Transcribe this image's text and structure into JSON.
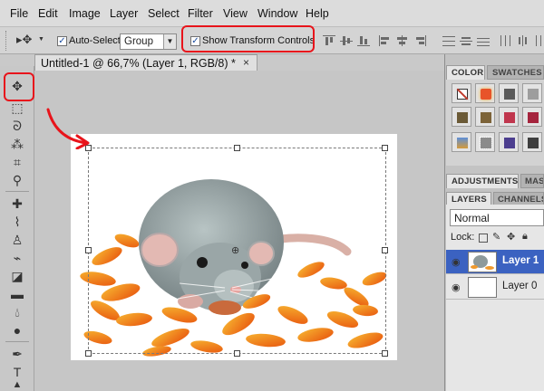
{
  "menu": [
    "File",
    "Edit",
    "Image",
    "Layer",
    "Select",
    "Filter",
    "View",
    "Window",
    "Help"
  ],
  "options": {
    "auto_select_label": "Auto-Select:",
    "auto_select_value": "Group",
    "show_transform_label": "Show Transform Controls",
    "check_mark": "✓"
  },
  "document": {
    "tab_title": "Untitled-1 @ 66,7% (Layer 1, RGB/8) *",
    "close_glyph": "×"
  },
  "panels": {
    "color_tab": "COLOR",
    "swatches_tab": "SWATCHES",
    "adjustments_tab": "ADJUSTMENTS",
    "masks_tab": "MAS",
    "layers_tab": "LAYERS",
    "channels_tab": "CHANNELS"
  },
  "layers": {
    "blend_mode": "Normal",
    "lock_label": "Lock:",
    "items": [
      {
        "name": "Layer 1",
        "selected": true
      },
      {
        "name": "Layer 0",
        "selected": false
      }
    ]
  },
  "annotation_color": "#e8141b",
  "selection_color": "#3b62c1"
}
